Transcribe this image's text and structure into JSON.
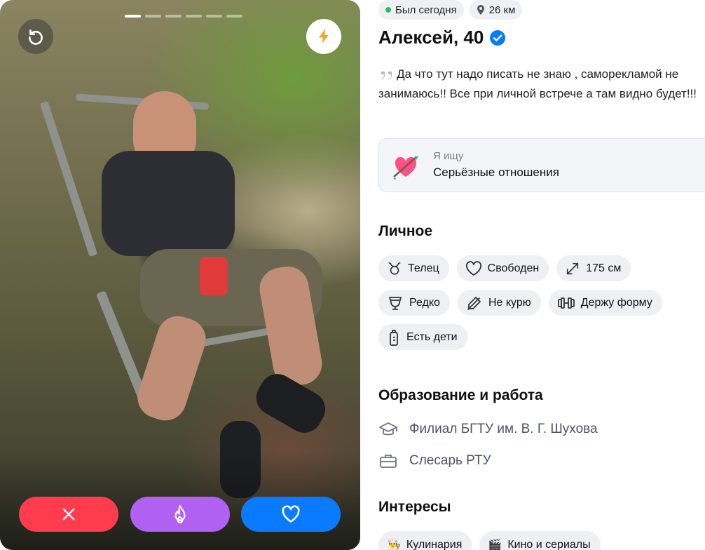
{
  "photo": {
    "alt": "",
    "progress_total": 6,
    "progress_active": 0
  },
  "buttons": {
    "undo": "undo-icon",
    "boost": "lightning-icon",
    "dislike": "close-icon",
    "super": "flame-icon",
    "like": "heart-icon"
  },
  "status": {
    "online": "Был сегодня",
    "distance": "26 км",
    "online_color": "#2fbd5a"
  },
  "profile": {
    "name_age": "Алексей, 40",
    "verified": true,
    "bio": "Да что тут надо писать не знаю , саморекламой не занимаюсь!! Все при личной встрече а там видно будет!!!"
  },
  "looking_for": {
    "caption": "Я ищу",
    "value": "Серьёзные отношения"
  },
  "personal": {
    "title": "Личное",
    "chips": [
      {
        "icon": "taurus-icon",
        "label": "Телец"
      },
      {
        "icon": "heart-outline-icon",
        "label": "Свободен"
      },
      {
        "icon": "expand-arrows-icon",
        "label": "175 см"
      },
      {
        "icon": "glass-icon",
        "label": "Редко"
      },
      {
        "icon": "no-smoking-icon",
        "label": "Не курю"
      },
      {
        "icon": "dumbbell-icon",
        "label": "Держу форму"
      },
      {
        "icon": "baby-bottle-icon",
        "label": "Есть дети"
      }
    ]
  },
  "education_work": {
    "title": "Образование и работа",
    "education": "Филиал БГТУ им. В. Г. Шухова",
    "work": "Слесарь РТУ"
  },
  "interests": {
    "title": "Интересы",
    "items": [
      {
        "emoji": "👨‍🍳",
        "label": "Кулинария"
      },
      {
        "emoji": "🎬",
        "label": "Кино и сериалы"
      }
    ]
  },
  "colors": {
    "dislike": "#ff3b4e",
    "super": "#b061f2",
    "like": "#0a7bff",
    "verified": "#0a7bff",
    "boost": "#f5a623"
  }
}
